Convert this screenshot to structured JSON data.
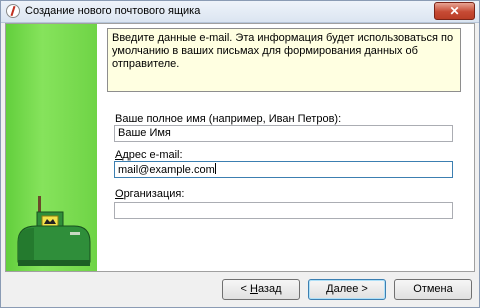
{
  "window": {
    "title": "Создание нового почтового ящика",
    "close_glyph": "✕"
  },
  "info": {
    "text": "Введите данные e-mail. Эта информация будет использоваться по умолчанию в ваших письмах для формирования данных об отправителе."
  },
  "fields": {
    "name": {
      "label": "Ваше полное имя (например, Иван Петров):",
      "value": "Ваше Имя"
    },
    "email": {
      "label_accel": "А",
      "label_rest": "дрес e-mail:",
      "value": "mail@example.com"
    },
    "org": {
      "label_accel": "О",
      "label_rest": "рганизация:",
      "value": ""
    }
  },
  "buttons": {
    "back": {
      "arrow": "<",
      "accel": "Н",
      "rest": "азад"
    },
    "next": {
      "accel": "Д",
      "rest": "алее",
      "arrow": ">"
    },
    "cancel": {
      "label": "Отмена"
    }
  },
  "colors": {
    "sidebar": "#6fd446",
    "info_bg": "#ffffe1",
    "close": "#c64a34"
  }
}
